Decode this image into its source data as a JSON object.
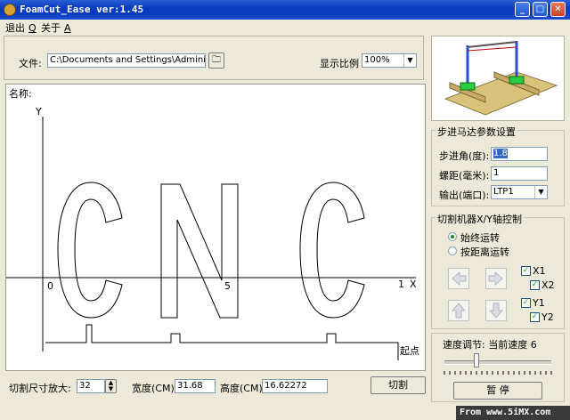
{
  "window": {
    "title": "FoamCut_Ease ver:1.45",
    "minimize": "_",
    "maximize": "□",
    "close": "✕"
  },
  "menu": [
    {
      "label": "退出",
      "key": "Q"
    },
    {
      "label": "关于",
      "key": "A"
    }
  ],
  "file": {
    "label": "文件:",
    "path": "C:\\Documents and Settings\\Administrator\\桌面",
    "scale_label": "显示比例",
    "scale_value": "100%"
  },
  "canvas": {
    "name_label": "名称:",
    "y_axis": "Y",
    "x_axis": "X",
    "tick_0": "0",
    "tick_5": "5",
    "tick_1": "1",
    "start_label": "起点",
    "text": "CNC"
  },
  "bottom": {
    "scale_label": "切割尺寸放大:",
    "scale_value": "32",
    "width_label": "宽度(CM):",
    "width_value": "31.68",
    "height_label": "高度(CM):",
    "height_value": "16.62272",
    "cut_button": "切割"
  },
  "stepper": {
    "title": "步进马达参数设置",
    "angle_label": "步进角(度):",
    "angle_value": "1.8",
    "pitch_label": "螺距(毫米):",
    "pitch_value": "1",
    "port_label": "输出(端口):",
    "port_value": "LTP1"
  },
  "xy": {
    "title": "切割机器X/Y轴控制",
    "radio_continuous": "始终运转",
    "radio_distance": "按距离运转",
    "x1": "X1",
    "x2": "X2",
    "y1": "Y1",
    "y2": "Y2"
  },
  "speed": {
    "label": "速度调节: 当前速度 6",
    "level": 6,
    "max": 20,
    "pause_button": "暂    停"
  },
  "watermark": "From www.5iMX.com",
  "colors": {
    "titlebar": "#0a3bbf",
    "window": "#ece9d8"
  }
}
